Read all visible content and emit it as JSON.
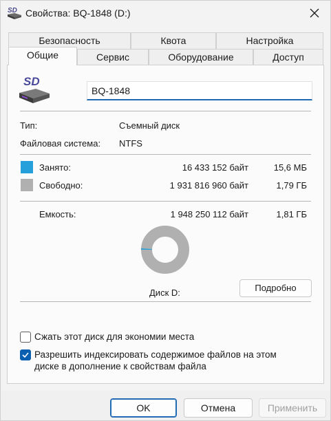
{
  "window": {
    "title": "Свойства: BQ-1848 (D:)",
    "icon": "sd-card-icon",
    "close_icon": "close-icon"
  },
  "tabs": {
    "row1": [
      {
        "label": "Безопасность"
      },
      {
        "label": "Квота"
      },
      {
        "label": "Настройка"
      }
    ],
    "row2": [
      {
        "label": "Общие",
        "active": true
      },
      {
        "label": "Сервис"
      },
      {
        "label": "Оборудование"
      },
      {
        "label": "Доступ"
      }
    ]
  },
  "general": {
    "drive_icon": "removable-sd-drive-icon",
    "drive_name": "BQ-1848",
    "type_label": "Тип:",
    "type_value": "Съемный диск",
    "fs_label": "Файловая система:",
    "fs_value": "NTFS",
    "used": {
      "label": "Занято:",
      "bytes": "16 433 152 байт",
      "size": "15,6 МБ",
      "color": "#26a0da"
    },
    "free": {
      "label": "Свободно:",
      "bytes": "1 931 816 960 байт",
      "size": "1,79 ГБ",
      "color": "#b0b0b0"
    },
    "capacity": {
      "label": "Емкость:",
      "bytes": "1 948 250 112 байт",
      "size": "1,81 ГБ"
    },
    "used_fraction": 0.0084,
    "disk_label": "Диск D:",
    "details_button": "Подробно"
  },
  "options": {
    "compress": {
      "label": "Сжать этот диск для экономии места",
      "checked": false
    },
    "index_line1": "Разрешить индексировать содержимое файлов на этом",
    "index_line2": "диске в дополнение к свойствам файла",
    "index_checked": true
  },
  "buttons": {
    "ok": "OK",
    "cancel": "Отмена",
    "apply": "Применить"
  },
  "colors": {
    "accent": "#1f6ab3",
    "used": "#26a0da",
    "free": "#b0b0b0"
  }
}
